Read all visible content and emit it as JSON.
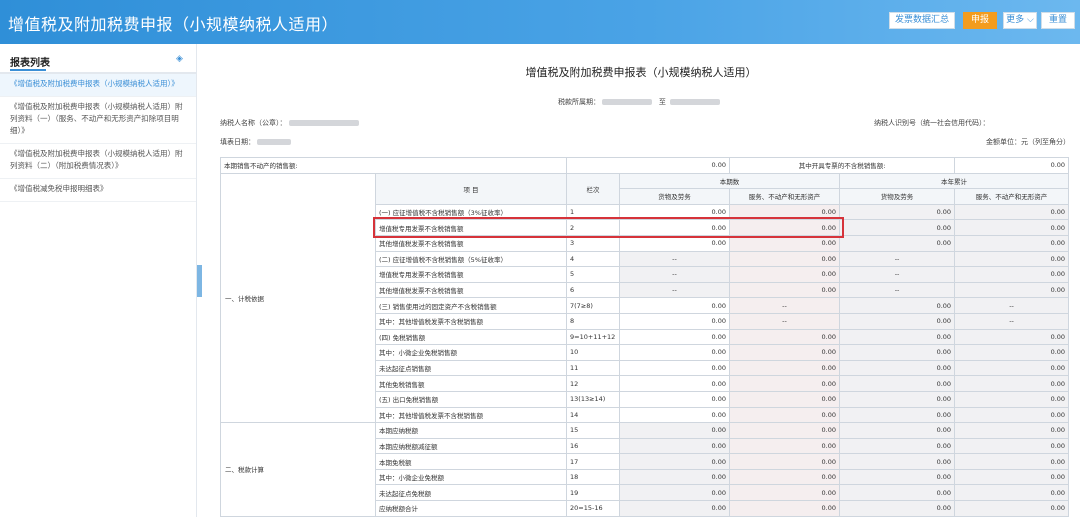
{
  "header": {
    "title": "增值税及附加税费申报（小规模纳税人适用）",
    "buttons": {
      "invoice_summary": "发票数据汇总",
      "declare": "申报",
      "more": "更多",
      "reset": "重置"
    }
  },
  "sidebar": {
    "title": "报表列表",
    "items": [
      {
        "label": "《增值税及附加税费申报表（小规模纳税人适用）》",
        "active": true
      },
      {
        "label": "《增值税及附加税费申报表（小规模纳税人适用）附列资料（一）（服务、不动产和无形资产扣除项目明细）》",
        "active": false
      },
      {
        "label": "《增值税及附加税费申报表（小规模纳税人适用）附列资料（二）（附加税费情况表）》",
        "active": false
      },
      {
        "label": "《增值税减免税申报明细表》",
        "active": false
      }
    ]
  },
  "form": {
    "title": "增值税及附加税费申报表（小规模纳税人适用）",
    "period_label": "税款所属期：",
    "period_to": "至",
    "taxpayer_name_label": "纳税人名称（公章）：",
    "taxpayer_id_label": "纳税人识别号（统一社会信用代码）：",
    "fill_date_label": "填表日期：",
    "unit_label": "金额单位：元（列至角分）"
  },
  "table": {
    "top_row": {
      "label_left": "本期销售不动产的销售额:",
      "value_left": "0.00",
      "label_right": "其中开具专票的不含税销售额:",
      "value_right": "0.00"
    },
    "headers": {
      "item": "项  目",
      "line": "栏次",
      "current": "本期数",
      "ytd": "本年累计",
      "goods": "货物及劳务",
      "services": "服务、不动产和无形资产"
    },
    "sections": {
      "basis": "一、计税依据",
      "calc": "二、税款计算"
    },
    "rows": [
      {
        "item": "(一) 应征增值税不含税销售额（3%征收率）",
        "line": "1",
        "c1": "0.00",
        "c2": "0.00",
        "y1": "0.00",
        "y2": "0.00",
        "indent": 1
      },
      {
        "item": "增值税专用发票不含税销售额",
        "line": "2",
        "c1": "0.00",
        "c2": "0.00",
        "y1": "0.00",
        "y2": "0.00",
        "indent": 2
      },
      {
        "item": "其他增值税发票不含税销售额",
        "line": "3",
        "c1": "0.00",
        "c2": "0.00",
        "y1": "0.00",
        "y2": "0.00",
        "indent": 2
      },
      {
        "item": "(二) 应征增值税不含税销售额（5%征收率）",
        "line": "4",
        "c1": "--",
        "c2": "0.00",
        "y1": "--",
        "y2": "0.00",
        "indent": 1
      },
      {
        "item": "增值税专用发票不含税销售额",
        "line": "5",
        "c1": "--",
        "c2": "0.00",
        "y1": "--",
        "y2": "0.00",
        "indent": 2
      },
      {
        "item": "其他增值税发票不含税销售额",
        "line": "6",
        "c1": "--",
        "c2": "0.00",
        "y1": "--",
        "y2": "0.00",
        "indent": 2
      },
      {
        "item": "(三) 销售使用过的固定资产不含税销售额",
        "line": "7(7≥8)",
        "c1": "0.00",
        "c2": "--",
        "y1": "0.00",
        "y2": "--",
        "indent": 1
      },
      {
        "item": "其中：其他增值税发票不含税销售额",
        "line": "8",
        "c1": "0.00",
        "c2": "--",
        "y1": "0.00",
        "y2": "--",
        "indent": 2
      },
      {
        "item": "(四) 免税销售额",
        "line": "9=10+11+12",
        "c1": "0.00",
        "c2": "0.00",
        "y1": "0.00",
        "y2": "0.00",
        "indent": 1
      },
      {
        "item": "其中：小微企业免税销售额",
        "line": "10",
        "c1": "0.00",
        "c2": "0.00",
        "y1": "0.00",
        "y2": "0.00",
        "indent": 2
      },
      {
        "item": "未达起征点销售额",
        "line": "11",
        "c1": "0.00",
        "c2": "0.00",
        "y1": "0.00",
        "y2": "0.00",
        "indent": 2
      },
      {
        "item": "其他免税销售额",
        "line": "12",
        "c1": "0.00",
        "c2": "0.00",
        "y1": "0.00",
        "y2": "0.00",
        "indent": 2
      },
      {
        "item": "(五) 出口免税销售额",
        "line": "13(13≥14)",
        "c1": "0.00",
        "c2": "0.00",
        "y1": "0.00",
        "y2": "0.00",
        "indent": 1
      },
      {
        "item": "其中：其他增值税发票不含税销售额",
        "line": "14",
        "c1": "0.00",
        "c2": "0.00",
        "y1": "0.00",
        "y2": "0.00",
        "indent": 2
      }
    ],
    "calc_rows": [
      {
        "item": "本期应纳税额",
        "line": "15",
        "c1": "0.00",
        "c2": "0.00",
        "y1": "0.00",
        "y2": "0.00"
      },
      {
        "item": "本期应纳税额减征额",
        "line": "16",
        "c1": "0.00",
        "c2": "0.00",
        "y1": "0.00",
        "y2": "0.00"
      },
      {
        "item": "本期免税额",
        "line": "17",
        "c1": "0.00",
        "c2": "0.00",
        "y1": "0.00",
        "y2": "0.00"
      },
      {
        "item": "其中：小微企业免税额",
        "line": "18",
        "c1": "0.00",
        "c2": "0.00",
        "y1": "0.00",
        "y2": "0.00"
      },
      {
        "item": "未达起征点免税额",
        "line": "19",
        "c1": "0.00",
        "c2": "0.00",
        "y1": "0.00",
        "y2": "0.00"
      },
      {
        "item": "应纳税额合计",
        "line": "20=15-16",
        "c1": "0.00",
        "c2": "0.00",
        "y1": "0.00",
        "y2": "0.00"
      }
    ]
  },
  "colors": {
    "header_blue": "#3b94dc",
    "primary_button": "#f39c1e",
    "highlight_border": "#d6333a",
    "link_blue": "#3b8fd6"
  }
}
